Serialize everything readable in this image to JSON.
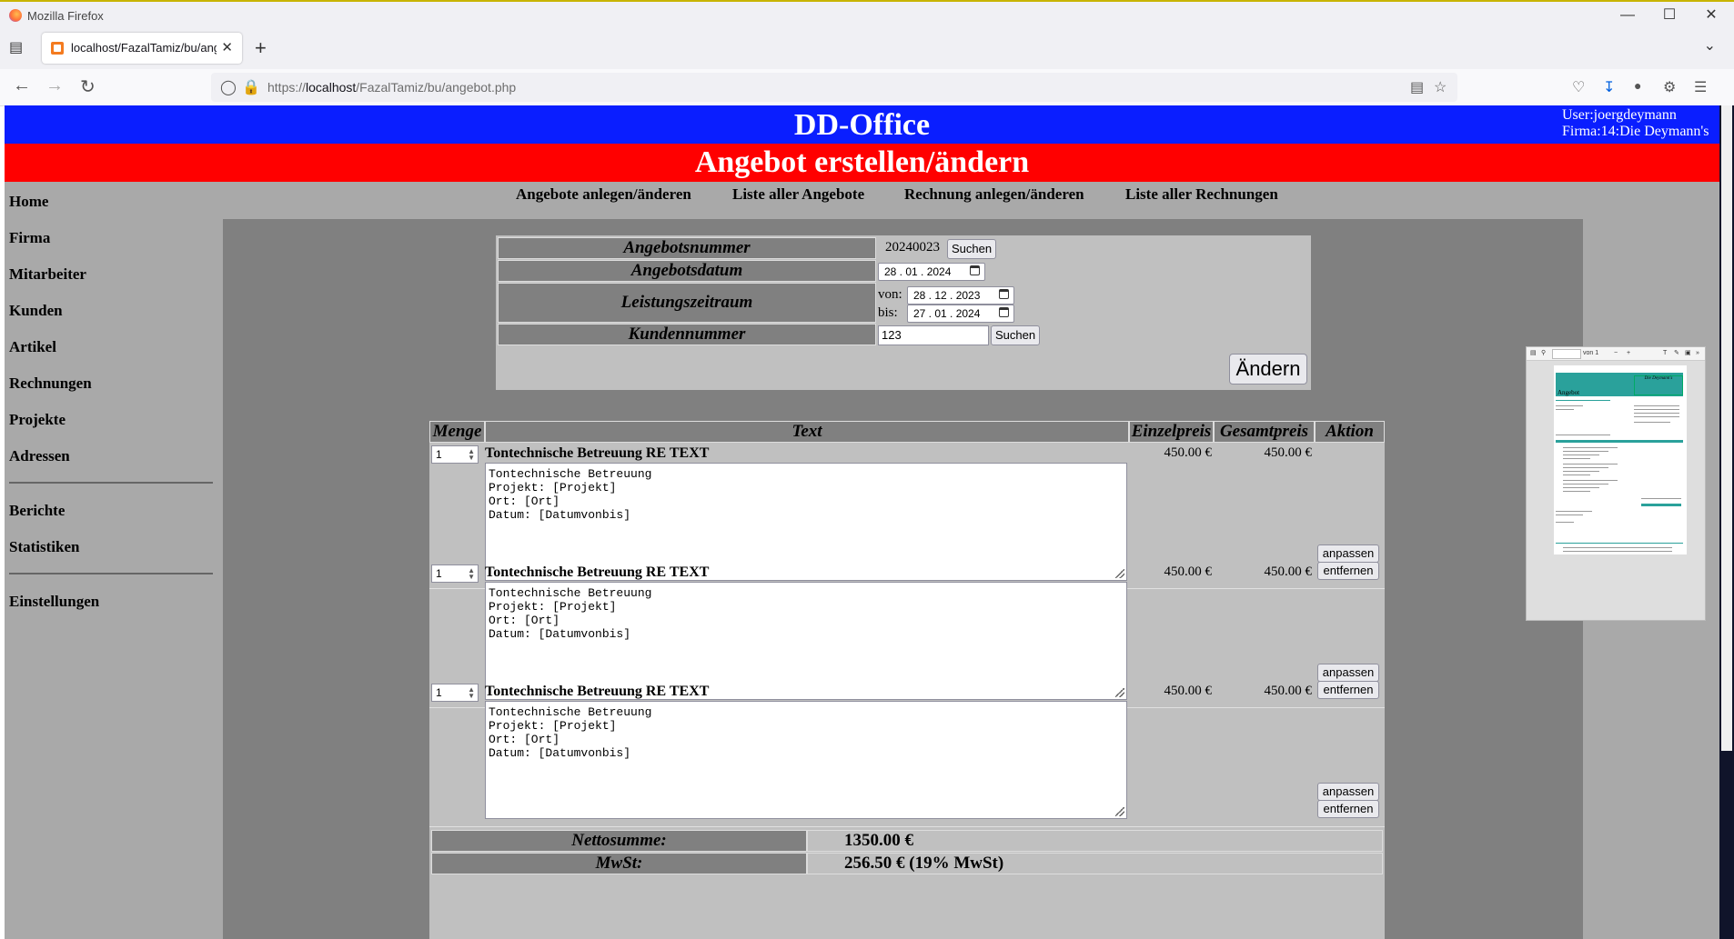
{
  "browser": {
    "window_title": "Mozilla Firefox",
    "tab_title": "localhost/FazalTamiz/bu/angebot.",
    "url_prefix": "https://",
    "url_host": "localhost",
    "url_path": "/FazalTamiz/bu/angebot.php"
  },
  "header": {
    "app_title": "DD-Office",
    "user_line": "User:joergdeymann",
    "firma_line": "Firma:14:Die Deymann's",
    "page_title": "Angebot erstellen/ändern",
    "brand_color": "#0a1eff",
    "title_color": "#ff0000"
  },
  "sidebar": {
    "items": [
      "Home",
      "Firma",
      "Mitarbeiter",
      "Kunden",
      "Artikel",
      "Rechnungen",
      "Projekte",
      "Adressen"
    ],
    "items2": [
      "Berichte",
      "Statistiken"
    ],
    "items3": [
      "Einstellungen"
    ]
  },
  "topnav": [
    "Angebote anlegen/änderen",
    "Liste aller Angebote",
    "Rechnung anlegen/änderen",
    "Liste aller Rechnungen"
  ],
  "form": {
    "angebotsnummer_label": "Angebotsnummer",
    "angebotsnummer": "20240023",
    "suchen": "Suchen",
    "angebotsdatum_label": "Angebotsdatum",
    "angebotsdatum": "28 . 01 . 2024",
    "leistungszeitraum_label": "Leistungszeitraum",
    "von_label": "von:",
    "von": "28 . 12 . 2023",
    "bis_label": "bis:",
    "bis": "27 . 01 . 2024",
    "kundennummer_label": "Kundennummer",
    "kundennummer": "123",
    "aendern": "Ändern"
  },
  "table": {
    "headers": [
      "Menge",
      "Text",
      "Einzelpreis",
      "Gesamtpreis",
      "Aktion"
    ],
    "items": [
      {
        "menge": "1",
        "title": "Tontechnische Betreuung RE TEXT",
        "text": "Tontechnische Betreuung\nProjekt: [Projekt]\nOrt: [Ort]\nDatum: [Datumvonbis]",
        "einzelpreis": "450.00 €",
        "gesamtpreis": "450.00 €"
      },
      {
        "menge": "1",
        "title": "Tontechnische Betreuung RE TEXT",
        "text": "Tontechnische Betreuung\nProjekt: [Projekt]\nOrt: [Ort]\nDatum: [Datumvonbis]",
        "einzelpreis": "450.00 €",
        "gesamtpreis": "450.00 €"
      },
      {
        "menge": "1",
        "title": "Tontechnische Betreuung RE TEXT",
        "text": "Tontechnische Betreuung\nProjekt: [Projekt]\nOrt: [Ort]\nDatum: [Datumvonbis]",
        "einzelpreis": "450.00 €",
        "gesamtpreis": "450.00 €"
      }
    ],
    "anpassen": "anpassen",
    "entfernen": "entfernen",
    "netto_label": "Nettosumme:",
    "netto": "1350.00 €",
    "mwst_label": "MwSt:",
    "mwst": "256.50 € (19% MwSt)"
  },
  "pdf_preview": {
    "page_indicator": "von 1",
    "doc_heading": "Angebot",
    "company": "Die Deymann's"
  }
}
